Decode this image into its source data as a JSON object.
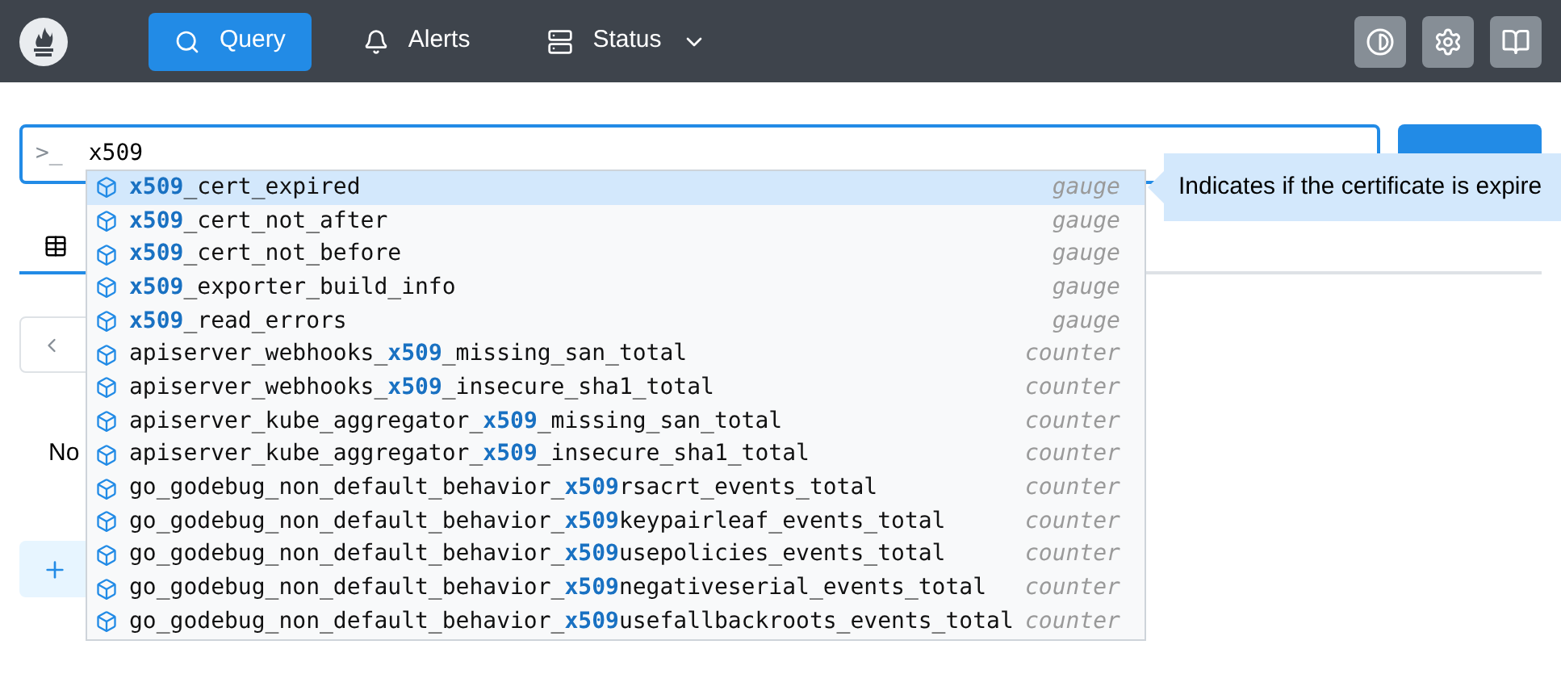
{
  "nav": {
    "items": [
      {
        "label": "Query",
        "selected": true,
        "dropdown": false
      },
      {
        "label": "Alerts",
        "selected": false,
        "dropdown": false
      },
      {
        "label": "Status",
        "selected": false,
        "dropdown": true
      }
    ]
  },
  "query": {
    "prompt": ">_",
    "value": "x509"
  },
  "suggestions": [
    {
      "name": "**x509**_cert_expired",
      "type": "gauge",
      "selected": true
    },
    {
      "name": "**x509**_cert_not_after",
      "type": "gauge",
      "selected": false
    },
    {
      "name": "**x509**_cert_not_before",
      "type": "gauge",
      "selected": false
    },
    {
      "name": "**x509**_exporter_build_info",
      "type": "gauge",
      "selected": false
    },
    {
      "name": "**x509**_read_errors",
      "type": "gauge",
      "selected": false
    },
    {
      "name": "apiserver_webhooks_**x509**_missing_san_total",
      "type": "counter",
      "selected": false
    },
    {
      "name": "apiserver_webhooks_**x509**_insecure_sha1_total",
      "type": "counter",
      "selected": false
    },
    {
      "name": "apiserver_kube_aggregator_**x509**_missing_san_total",
      "type": "counter",
      "selected": false
    },
    {
      "name": "apiserver_kube_aggregator_**x509**_insecure_sha1_total",
      "type": "counter",
      "selected": false
    },
    {
      "name": "go_godebug_non_default_behavior_**x509**rsacrt_events_total",
      "type": "counter",
      "selected": false
    },
    {
      "name": "go_godebug_non_default_behavior_**x509**keypairleaf_events_total",
      "type": "counter",
      "selected": false
    },
    {
      "name": "go_godebug_non_default_behavior_**x509**usepolicies_events_total",
      "type": "counter",
      "selected": false
    },
    {
      "name": "go_godebug_non_default_behavior_**x509**negativeserial_events_total",
      "type": "counter",
      "selected": false
    },
    {
      "name": "go_godebug_non_default_behavior_**x509**usefallbackroots_events_total",
      "type": "counter",
      "selected": false
    }
  ],
  "tooltip": "Indicates if the certificate is expire",
  "panel": {
    "empty_text": "No"
  }
}
